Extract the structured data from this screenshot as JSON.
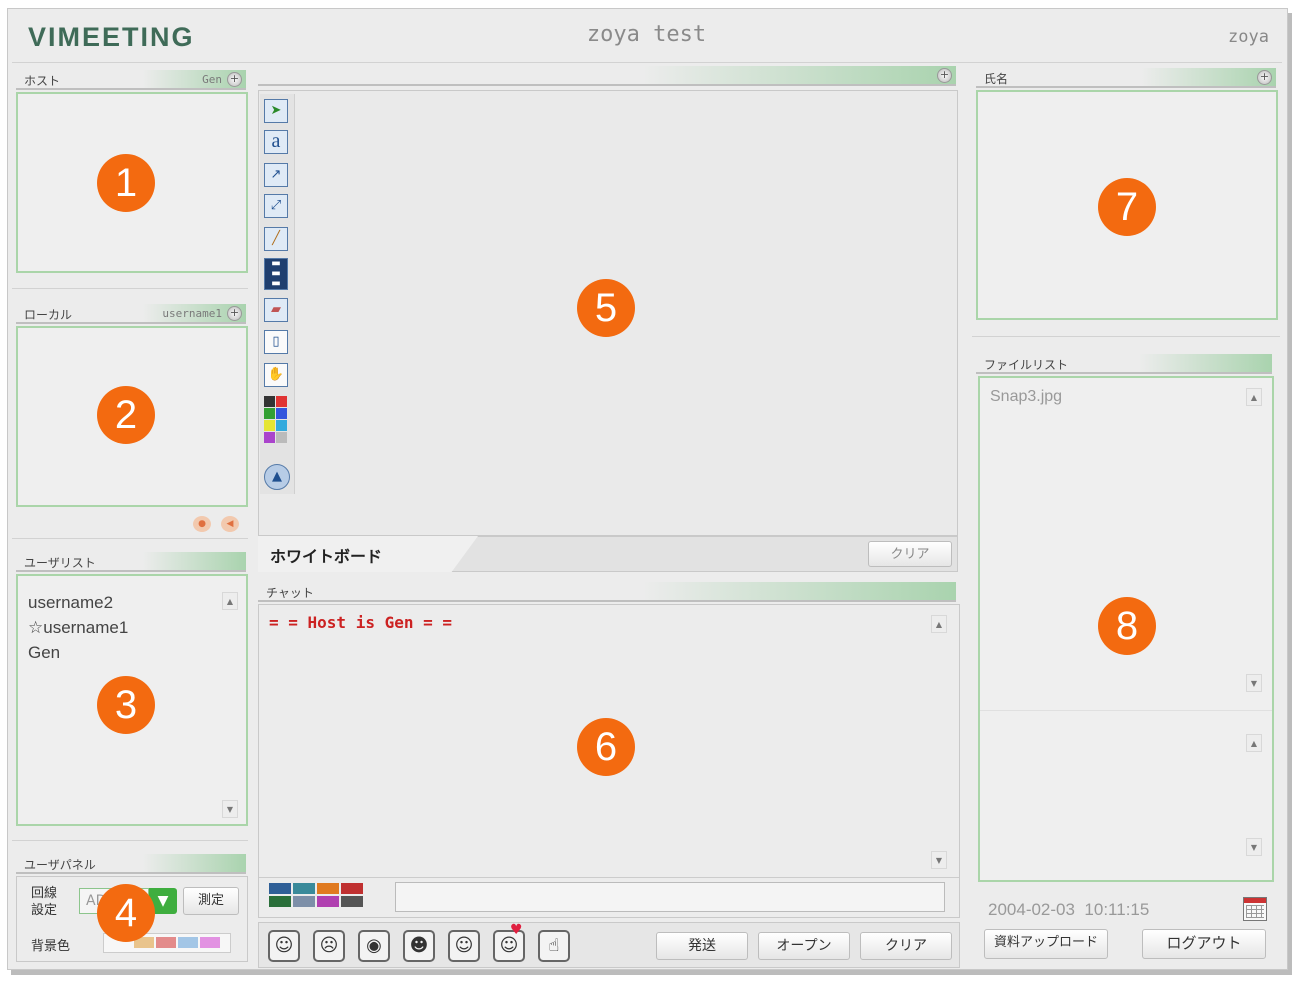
{
  "app": {
    "logo": "VIMEETING",
    "title": "zoya test",
    "username": "zoya"
  },
  "host_panel": {
    "label": "ホスト",
    "value": "Gen",
    "badge": "1"
  },
  "local_panel": {
    "label": "ローカル",
    "value": "username1",
    "badge": "2"
  },
  "user_list": {
    "label": "ユーザリスト",
    "users": [
      "username2",
      "☆username1",
      "Gen"
    ],
    "badge": "3"
  },
  "user_panel": {
    "label": "ユーザパネル",
    "line_label_1": "回線",
    "line_label_2": "設定",
    "line_value": "AD",
    "measure_button": "測定",
    "bg_label": "背景色",
    "badge": "4",
    "bg_colors": [
      "#e9c48c",
      "#e38b8b",
      "#a3c6e6",
      "#e292e2"
    ]
  },
  "whiteboard": {
    "tab_label": "ホワイトボード",
    "clear_button": "クリア",
    "badge": "5",
    "tools": [
      "select-arrow-icon",
      "text-icon",
      "arrow-line-icon",
      "double-arrow-icon",
      "pen-icon",
      "line-width-icon",
      "eraser-icon",
      "new-page-icon",
      "hand-icon",
      "color-palette-icon",
      "scroll-up-icon"
    ],
    "palette": [
      "#333333",
      "#e03333",
      "#33a033",
      "#3355dd",
      "#e5e533",
      "#33aadd",
      "#aa44cc",
      "#bbbbbb"
    ]
  },
  "chat": {
    "label": "チャット",
    "message": "= = Host is Gen = =",
    "message_color": "#cc2222",
    "badge": "6",
    "send_button": "発送",
    "open_button": "オープン",
    "clear_button": "クリア",
    "colors": [
      "#2f5f97",
      "#3a8a9a",
      "#e07a20",
      "#c03030",
      "#2a6f3a",
      "#7d8fa8",
      "#b040b0",
      "#555555"
    ],
    "emoticons": [
      "smile-face-icon",
      "sad-face-icon",
      "surprised-face-icon",
      "wink-face-icon",
      "tongue-face-icon",
      "heart-face-icon",
      "hand-face-icon"
    ]
  },
  "name_panel": {
    "label": "氏名",
    "badge": "7"
  },
  "file_list": {
    "label": "ファイルリスト",
    "files": [
      "Snap3.jpg"
    ],
    "badge": "8"
  },
  "footer": {
    "date": "2004-02-03",
    "time": "10:11:15",
    "upload_button": "資料アップロード",
    "logout_button": "ログアウト"
  }
}
